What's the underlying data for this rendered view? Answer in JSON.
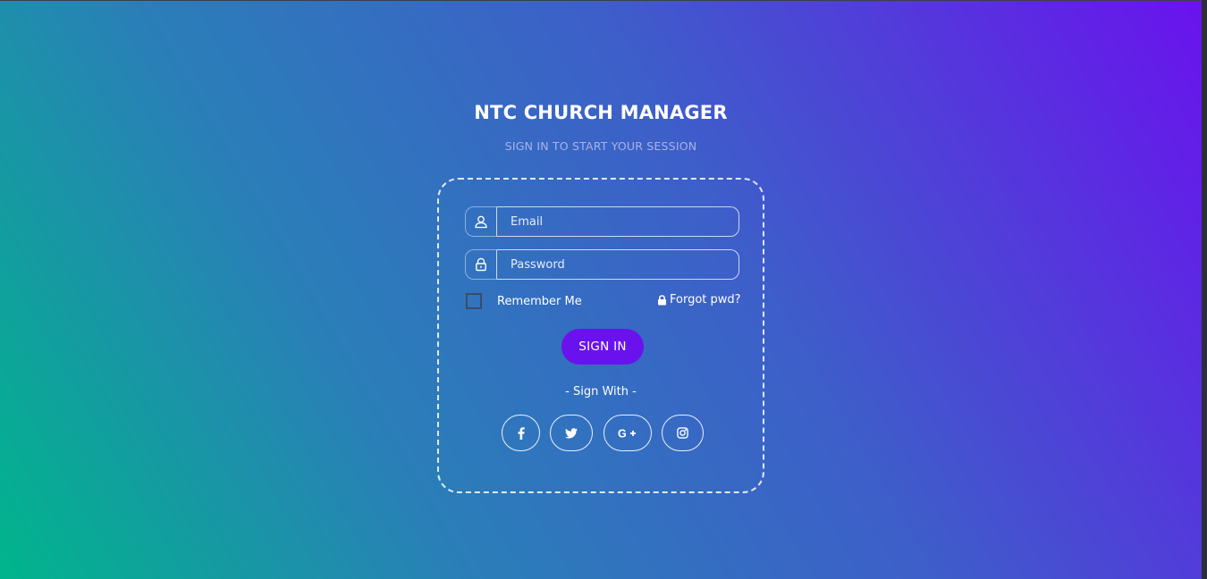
{
  "app": {
    "title": "NTC CHURCH MANAGER",
    "subtitle": "SIGN IN TO START YOUR SESSION"
  },
  "form": {
    "email": {
      "placeholder": "Email",
      "value": "",
      "icon": "user-icon"
    },
    "password": {
      "placeholder": "Password",
      "value": "",
      "icon": "lock-icon"
    },
    "remember_label": "Remember Me",
    "remember_checked": false,
    "forgot_label": "Forgot pwd?",
    "forgot_icon": "lock-icon",
    "signin_label": "SIGN IN"
  },
  "social": {
    "label": "- Sign With -",
    "buttons": [
      {
        "icon": "facebook-icon"
      },
      {
        "icon": "twitter-icon"
      },
      {
        "icon": "google-plus-icon",
        "text": "G+"
      },
      {
        "icon": "instagram-icon"
      }
    ]
  },
  "colors": {
    "accent": "#6a12ee",
    "gradient_start": "#00b58c",
    "gradient_mid": "#3d5fc9",
    "gradient_end": "#6a12ee",
    "subtitle": "#a9b3e6"
  }
}
